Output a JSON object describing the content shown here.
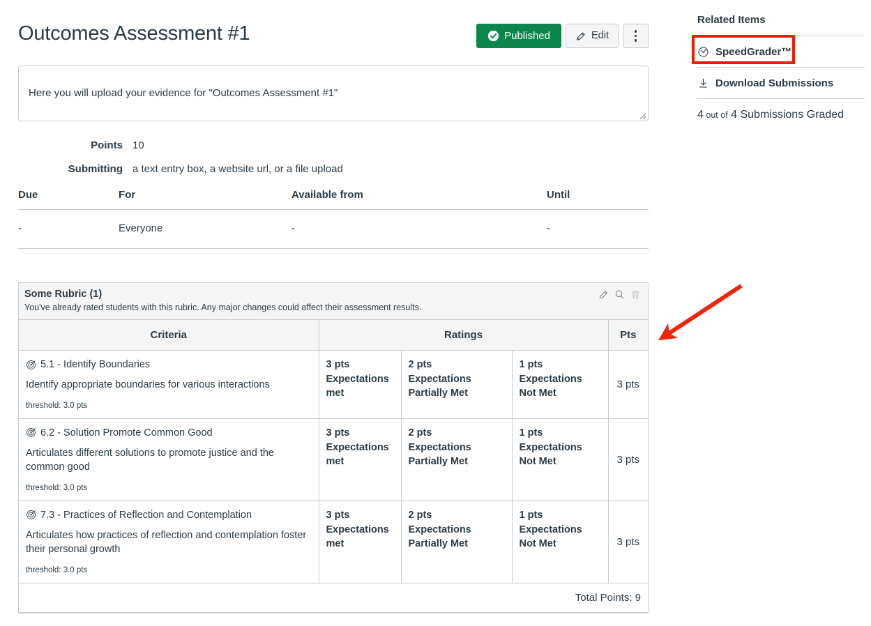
{
  "header": {
    "title": "Outcomes Assessment #1",
    "published_label": "Published",
    "edit_label": "Edit",
    "published_color": "#0b874b"
  },
  "description": {
    "text": "Here you will upload your evidence for \"Outcomes Assessment #1\""
  },
  "meta": [
    {
      "label": "Points",
      "value": "10"
    },
    {
      "label": "Submitting",
      "value": "a text entry box, a website url, or a file upload"
    }
  ],
  "dates_table": {
    "headers": [
      "Due",
      "For",
      "Available from",
      "Until"
    ],
    "rows": [
      {
        "due": "-",
        "for": "Everyone",
        "available_from": "-",
        "until": "-"
      }
    ]
  },
  "rubric": {
    "title": "Some Rubric (1)",
    "warning": "You've already rated students with this rubric. Any major changes could affect their assessment results.",
    "actions": [
      "pencil-icon",
      "magnifier-icon",
      "trash-icon"
    ],
    "headers": [
      "Criteria",
      "Ratings",
      "Pts"
    ],
    "total_label": "Total Points: 9",
    "criteria": [
      {
        "name": "5.1 - Identify Boundaries",
        "description": "Identify appropriate boundaries for various interactions",
        "threshold": "threshold: 3.0 pts",
        "ratings": [
          {
            "pts": "3 pts",
            "desc": "Expectations met"
          },
          {
            "pts": "2 pts",
            "desc": "Expectations Partially Met"
          },
          {
            "pts": "1 pts",
            "desc": "Expectations Not Met"
          }
        ],
        "points": "3 pts"
      },
      {
        "name": "6.2 - Solution Promote Common Good",
        "description": "Articulates different solutions to promote justice and the common good",
        "threshold": "threshold: 3.0 pts",
        "ratings": [
          {
            "pts": "3 pts",
            "desc": "Expectations met"
          },
          {
            "pts": "2 pts",
            "desc": "Expectations Partially Met"
          },
          {
            "pts": "1 pts",
            "desc": "Expectations Not Met"
          }
        ],
        "points": "3 pts"
      },
      {
        "name": "7.3 - Practices of Reflection and Contemplation",
        "description": "Articulates how practices of reflection and contemplation foster their personal growth",
        "threshold": "threshold: 3.0 pts",
        "ratings": [
          {
            "pts": "3 pts",
            "desc": "Expectations met"
          },
          {
            "pts": "2 pts",
            "desc": "Expectations Partially Met"
          },
          {
            "pts": "1 pts",
            "desc": "Expectations Not Met"
          }
        ],
        "points": "3 pts"
      }
    ]
  },
  "sidebar": {
    "title": "Related Items",
    "speedgrader_label": "SpeedGrader™",
    "download_label": "Download Submissions",
    "status": {
      "graded_count": "4",
      "out_of": "out of",
      "total_count": "4",
      "suffix": "Submissions Graded"
    }
  },
  "annotations": {
    "highlight_color": "#f01c00",
    "arrow_color": "#f0240c",
    "highlight_target": "speedgrader-link",
    "arrow_points_to": "speedgrader-link"
  }
}
